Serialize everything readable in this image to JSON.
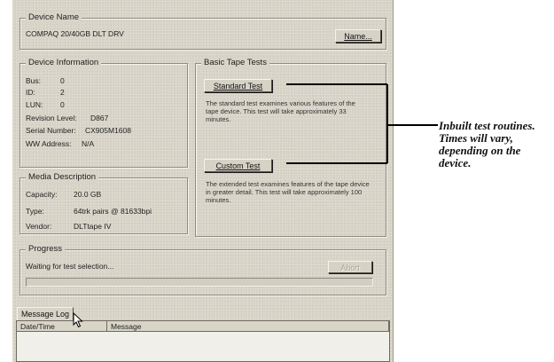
{
  "device_name": {
    "legend": "Device Name",
    "value": "COMPAQ 20/40GB DLT DRV",
    "button": "Name..."
  },
  "device_information": {
    "legend": "Device Information",
    "rows": [
      {
        "label": "Bus:",
        "value": "0"
      },
      {
        "label": "ID:",
        "value": "2"
      },
      {
        "label": "LUN:",
        "value": "0"
      },
      {
        "label": "Revision Level:",
        "value": "D867"
      },
      {
        "label": "Serial Number:",
        "value": "CX905M1608"
      },
      {
        "label": "WW Address:",
        "value": "N/A"
      }
    ]
  },
  "media_description": {
    "legend": "Media Description",
    "rows": [
      {
        "label": "Capacity:",
        "value": "20.0 GB"
      },
      {
        "label": "Type:",
        "value": "64trk pairs @ 81633bpi"
      },
      {
        "label": "Vendor:",
        "value": "DLTtape IV"
      }
    ]
  },
  "basic_tape_tests": {
    "legend": "Basic Tape Tests",
    "standard_button": "Standard Test",
    "standard_desc": "The standard test examines various features of the tape device. This test will take approximately 33 minutes.",
    "custom_button": "Custom Test",
    "custom_desc": "The extended test examines features of the tape device in greater detail. This test will take approximately 100 minutes."
  },
  "progress": {
    "legend": "Progress",
    "status": "Waiting for test selection...",
    "abort_button": "Abort",
    "fill_percent": 0
  },
  "message_log": {
    "tab_label": "Message Log",
    "columns": [
      "Date/Time",
      "Message"
    ]
  },
  "annotation": {
    "lines": [
      "Inbuilt test routines.",
      "Times will vary,",
      "depending on the",
      "device."
    ]
  },
  "colors": {
    "panel": "#d8d4c8",
    "callout_line": "#000000"
  }
}
